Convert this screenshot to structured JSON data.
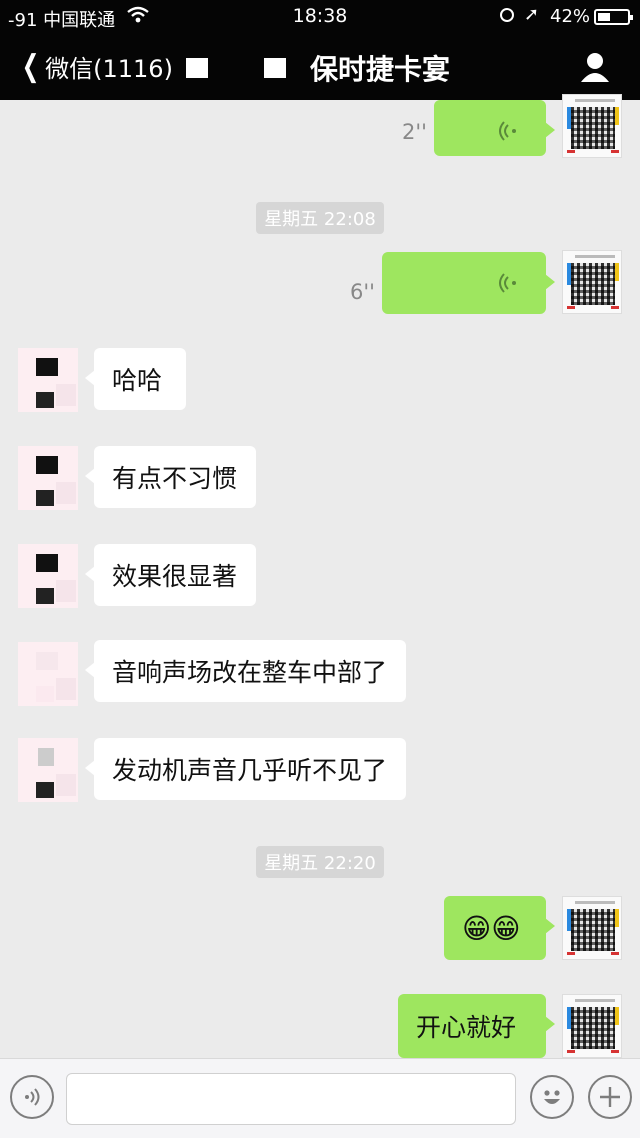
{
  "status_bar": {
    "carrier": "-91 中国联通",
    "time": "18:38",
    "battery_percent": "42%",
    "battery_level": 0.42,
    "icons": [
      "wifi-icon",
      "lock-rotation-icon",
      "location-icon",
      "battery-icon"
    ]
  },
  "nav": {
    "back_label": "微信(1116)",
    "title": "保时捷卡宴",
    "icons": [
      "chevron-left-icon",
      "contact-info-icon"
    ]
  },
  "messages": [
    {
      "side": "me",
      "type": "voice",
      "duration": "2''"
    },
    {
      "type": "timestamp",
      "text": "星期五 22:08"
    },
    {
      "side": "me",
      "type": "voice",
      "duration": "6''"
    },
    {
      "side": "other",
      "type": "text",
      "text": "哈哈"
    },
    {
      "side": "other",
      "type": "text",
      "text": "有点不习惯"
    },
    {
      "side": "other",
      "type": "text",
      "text": "效果很显著"
    },
    {
      "side": "other",
      "type": "text",
      "text": "音响声场改在整车中部了"
    },
    {
      "side": "other",
      "type": "text",
      "text": "发动机声音几乎听不见了"
    },
    {
      "type": "timestamp",
      "text": "星期五 22:20"
    },
    {
      "side": "me",
      "type": "text",
      "text": "😁😁"
    },
    {
      "side": "me",
      "type": "text",
      "text": "开心就好"
    }
  ],
  "input_bar": {
    "value": "",
    "icons": [
      "voice-mode-icon",
      "emoji-icon",
      "plus-icon"
    ]
  },
  "colors": {
    "outgoing_bubble": "#9ee65f",
    "incoming_bubble": "#ffffff",
    "chat_background": "#ebebeb",
    "header": "#050505"
  }
}
